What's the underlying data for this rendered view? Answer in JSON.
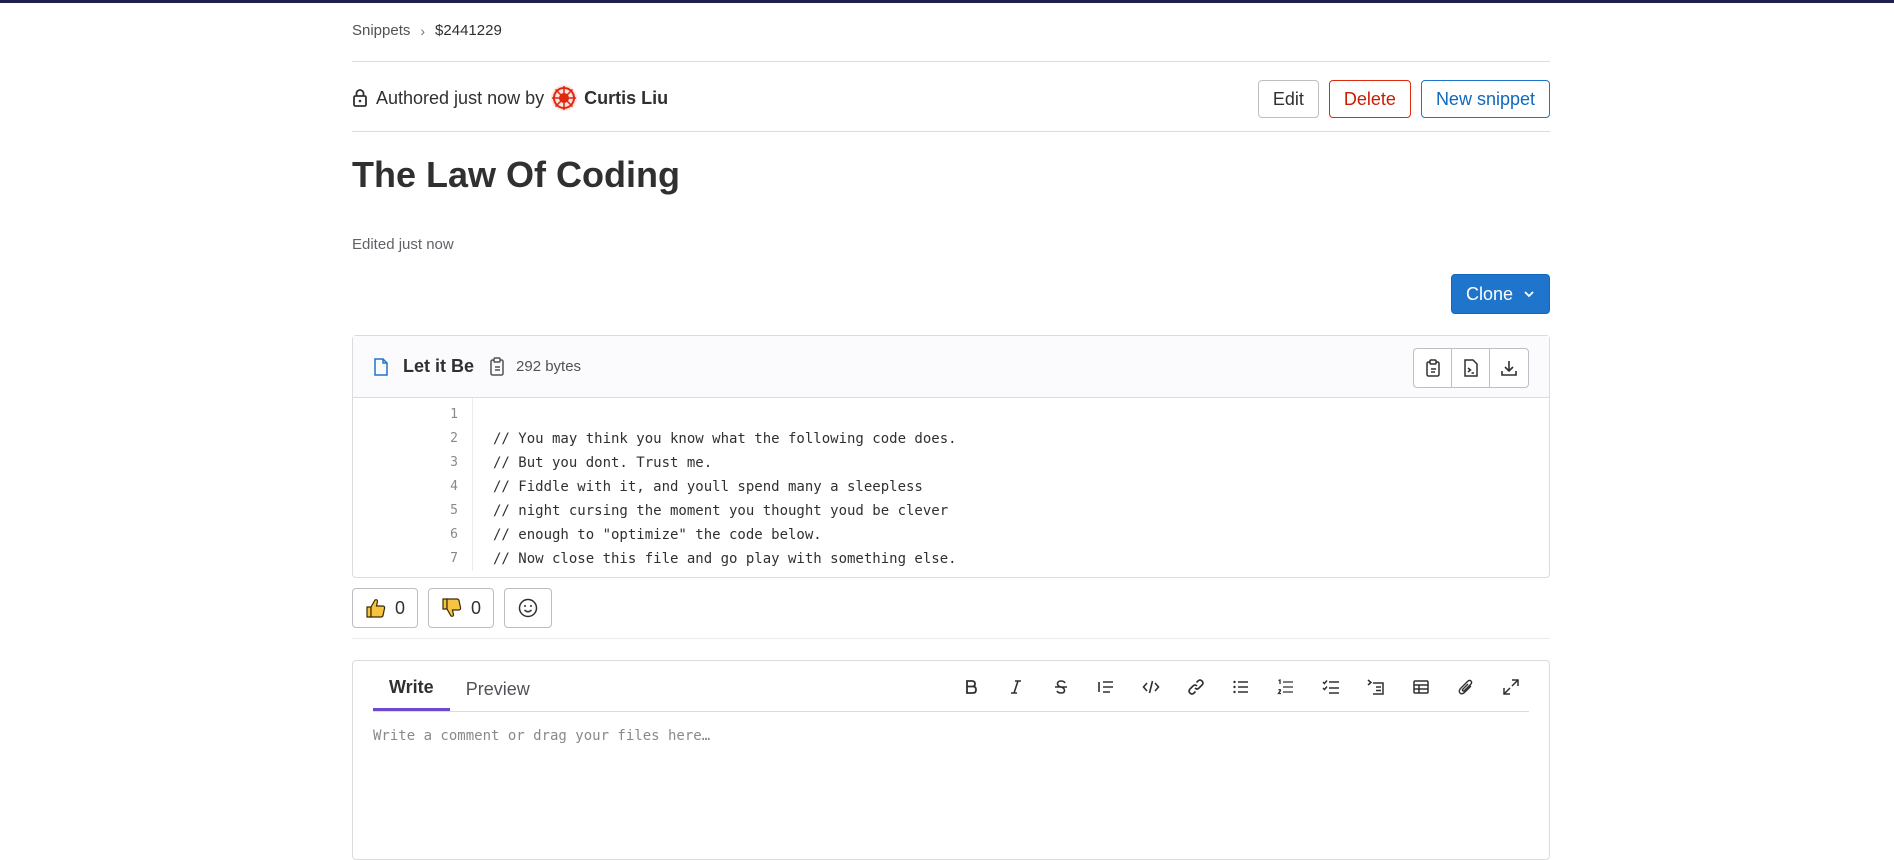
{
  "breadcrumb": {
    "root": "Snippets",
    "current": "$2441229"
  },
  "author": {
    "prefix": "Authored just now by",
    "name": "Curtis Liu"
  },
  "actions": {
    "edit": "Edit",
    "delete": "Delete",
    "new_snippet": "New snippet"
  },
  "snippet": {
    "title": "The Law Of Coding",
    "edited": "Edited just now"
  },
  "clone": {
    "label": "Clone"
  },
  "file": {
    "name": "Let it Be",
    "size": "292 bytes",
    "tools": [
      "copy-contents-icon",
      "open-raw-icon",
      "download-icon"
    ],
    "line_numbers": [
      "1",
      "2",
      "3",
      "4",
      "5",
      "6",
      "7"
    ],
    "lines": [
      "",
      "// You may think you know what the following code does.",
      "// But you dont. Trust me.",
      "// Fiddle with it, and youll spend many a sleepless",
      "// night cursing the moment you thought youd be clever",
      "// enough to \"optimize\" the code below.",
      "// Now close this file and go play with something else."
    ]
  },
  "awards": {
    "thumbs_up": "0",
    "thumbs_down": "0"
  },
  "comment": {
    "tab_write": "Write",
    "tab_preview": "Preview",
    "placeholder": "Write a comment or drag your files here…",
    "toolbar": [
      "bold-icon",
      "italic-icon",
      "strikethrough-icon",
      "quote-icon",
      "code-icon",
      "link-icon",
      "bullet-list-icon",
      "numbered-list-icon",
      "task-list-icon",
      "collapsible-icon",
      "table-icon",
      "attach-icon",
      "fullscreen-icon"
    ]
  },
  "colors": {
    "primary": "#1f75cb",
    "danger": "#dd2b0e",
    "tab_accent": "#6e49cb"
  }
}
